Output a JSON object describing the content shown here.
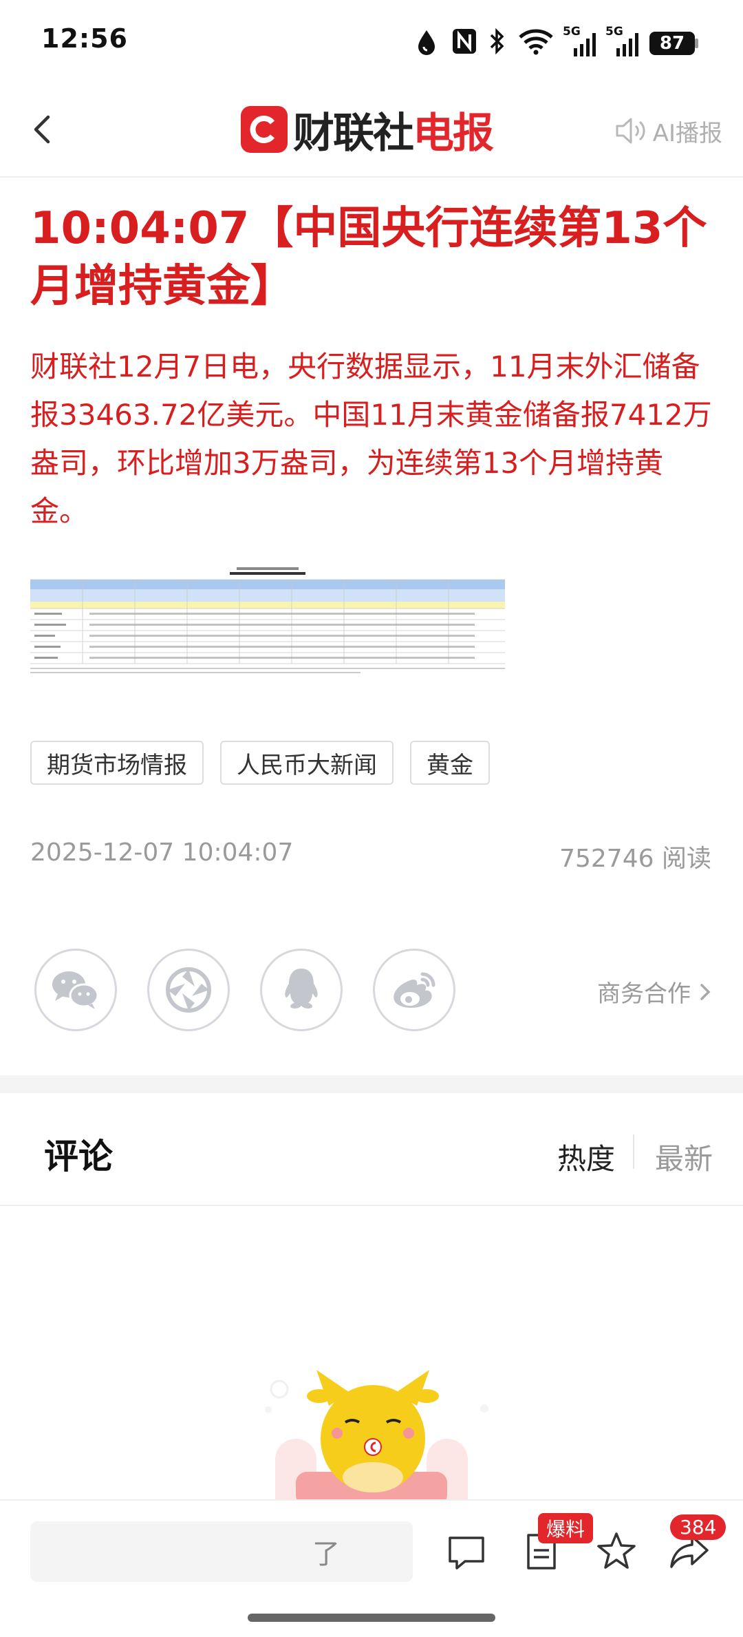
{
  "status_bar": {
    "time": "12:56",
    "battery": "87",
    "network_1": "5G",
    "network_2": "5G"
  },
  "header": {
    "logo_main": "财联社",
    "logo_accent": "电报",
    "ai_broadcast": "AI播报"
  },
  "article": {
    "headline": "10:04:07【中国央行连续第13个月增持黄金】",
    "body": "财联社12月7日电，央行数据显示，11月末外汇储备报33463.72亿美元。中国11月末黄金储备报7412万盎司，环比增加3万盎司，为连续第13个月增持黄金。",
    "tags": [
      "期货市场情报",
      "人民币大新闻",
      "黄金"
    ],
    "published_at": "2025-12-07 10:04:07",
    "read_count": "752746",
    "read_label": "阅读"
  },
  "share": {
    "icons": [
      "wechat-icon",
      "moments-icon",
      "qq-icon",
      "weibo-icon"
    ],
    "business_label": "商务合作"
  },
  "comments": {
    "title": "评论",
    "sort_hot": "热度",
    "sort_new": "最新"
  },
  "bottom_bar": {
    "input_placeholder": "了",
    "baoliao_label": "爆料",
    "share_count": "384"
  },
  "colors": {
    "brand_red": "#e3262b",
    "headline_red": "#d81e1e"
  }
}
